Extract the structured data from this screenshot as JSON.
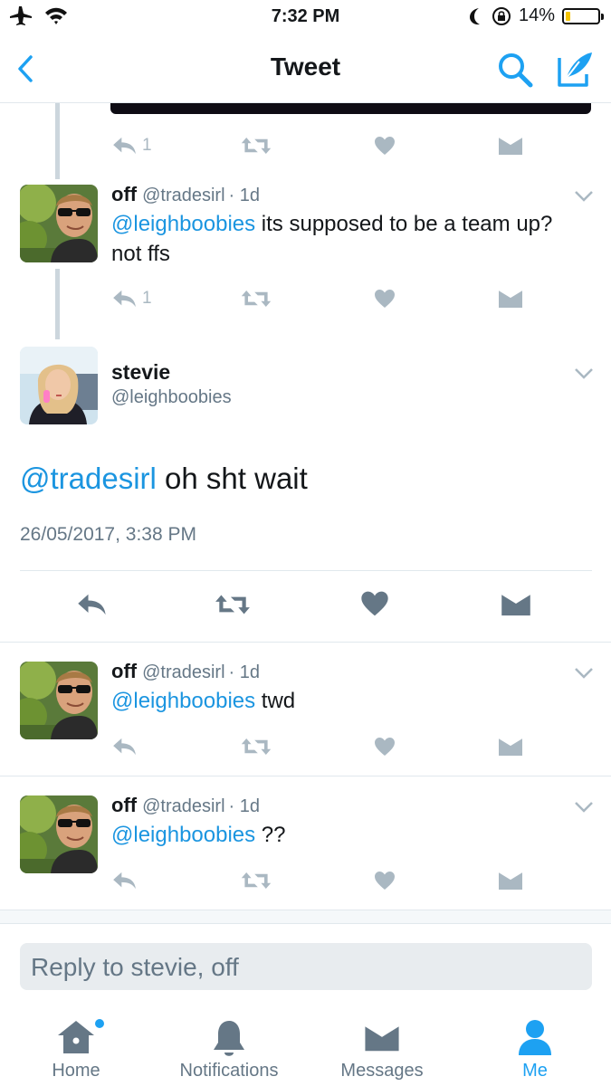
{
  "status_bar": {
    "time": "7:32 PM",
    "battery": "14%",
    "battery_level": 0.14
  },
  "nav": {
    "title": "Tweet"
  },
  "replies_above": [
    {
      "reply_count": "1"
    },
    {
      "name": "off",
      "handle": "@tradesirl",
      "time": "· 1d",
      "mention": "@leighboobies",
      "text": " its supposed to be a team up? not ffs",
      "reply_count": "1"
    }
  ],
  "focus_tweet": {
    "name": "stevie",
    "handle": "@leighboobies",
    "mention": "@tradesirl",
    "text": " oh sht wait",
    "timestamp": "26/05/2017, 3:38 PM"
  },
  "replies_below": [
    {
      "name": "off",
      "handle": "@tradesirl",
      "time": "· 1d",
      "mention": "@leighboobies",
      "text": " twd"
    },
    {
      "name": "off",
      "handle": "@tradesirl",
      "time": "· 1d",
      "mention": "@leighboobies",
      "text": " ??"
    }
  ],
  "reply_box": {
    "placeholder": "Reply to stevie, off"
  },
  "tabs": [
    {
      "label": "Home",
      "icon": "home-icon"
    },
    {
      "label": "Notifications",
      "icon": "bell-icon"
    },
    {
      "label": "Messages",
      "icon": "envelope-icon"
    },
    {
      "label": "Me",
      "icon": "person-icon"
    }
  ],
  "colors": {
    "accent": "#1da1f2",
    "mention": "#1b95e0",
    "muted": "#aab8c2",
    "text": "#14171a",
    "secondary": "#657786"
  }
}
